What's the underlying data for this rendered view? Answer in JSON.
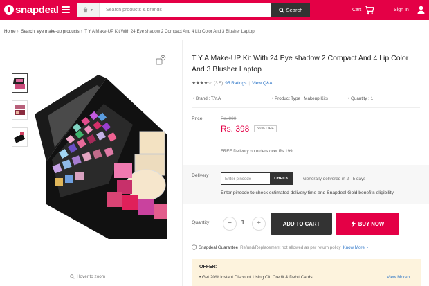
{
  "header": {
    "logo_text": "snapdeal",
    "search_placeholder": "Search products & brands",
    "search_button": "Search",
    "cart_label": "Cart",
    "signin_label": "Sign In",
    "brand_color": "#e40046"
  },
  "breadcrumb": [
    "Home",
    "Search: eye make-up products",
    "T Y A Make-UP Kit With 24 Eye shadow 2 Compact And 4 Lip Color And 3 Blusher Laptop"
  ],
  "gallery": {
    "hover_hint": "Hover to zoom",
    "thumbnails": 3
  },
  "product": {
    "title": "T Y A Make-UP Kit With 24 Eye shadow 2 Compact And 4 Lip Color And 3 Blusher Laptop",
    "rating": "(3.5)",
    "stars": "★★★★☆",
    "ratings_count": "95 Ratings",
    "view_qa": "View Q&A",
    "brand": "Brand : T.Y.A",
    "product_type": "Product Type : Makeup Kits",
    "quantity_attr": "Quantity : 1",
    "price_label": "Price",
    "mrp": "Rs. 900",
    "price": "Rs. 398",
    "discount": "56% OFF",
    "free_delivery": "FREE Delivery on orders over Rs.199"
  },
  "delivery": {
    "label": "Delivery",
    "pincode_placeholder": "Enter pincode",
    "check_button": "CHECK",
    "info": "Generally delivered in 2 - 5 days",
    "note": "Enter pincode to check estimated delivery time and Snapdeal Gold benefits eligibility"
  },
  "purchase": {
    "quantity_label": "Quantity",
    "quantity_value": "1",
    "minus": "−",
    "plus": "+",
    "add_to_cart": "ADD TO CART",
    "buy_now": "BUY NOW"
  },
  "guarantee": {
    "title": "Snapdeal Guarantee",
    "text": "Refund/Replacement not allowed as per return policy",
    "link": "Know More"
  },
  "offer": {
    "title": "OFFER:",
    "item": "Get 20% Instant Discount Using Citi Credit & Debit Cards",
    "view_more": "View More"
  }
}
